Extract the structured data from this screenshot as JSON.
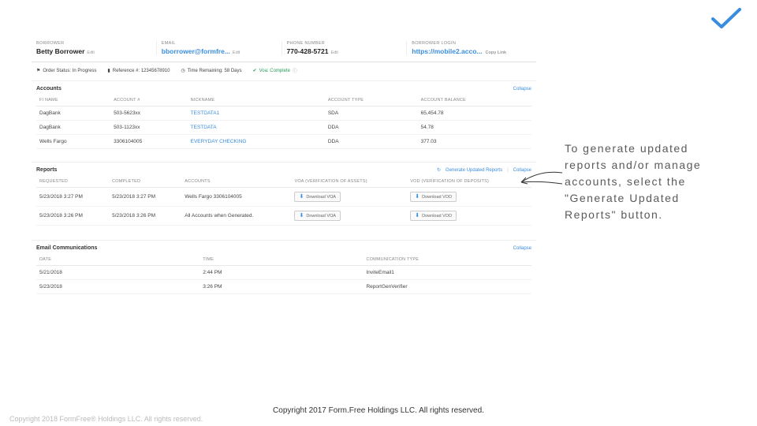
{
  "header": {
    "borrower_label": "BORROWER",
    "borrower_name": "Betty Borrower",
    "email_label": "EMAIL",
    "email_value": "bborrower@formfre...",
    "phone_label": "PHONE NUMBER",
    "phone_value": "770-428-5721",
    "url_label": "BORROWER LOGIN",
    "url_value": "https://mobile2.acco...",
    "edit": "Edit",
    "copy_link": "Copy Link"
  },
  "status": {
    "order": "Order Status: In Progress",
    "ref": "Reference #: 12345678910",
    "time": "Time Remaining: 58 Days",
    "voa": "Voa: Complete"
  },
  "accounts": {
    "title": "Accounts",
    "collapse": "Collapse",
    "cols": {
      "fi": "FI NAME",
      "acct": "ACCOUNT #",
      "nick": "NICKNAME",
      "type": "ACCOUNT TYPE",
      "bal": "ACCOUNT BALANCE"
    },
    "rows": [
      {
        "fi": "DagBank",
        "acct": "503-5623xx",
        "nick": "TESTDATA1",
        "type": "SDA",
        "bal": "65,454.78"
      },
      {
        "fi": "DagBank",
        "acct": "503-1123xx",
        "nick": "TESTDATA",
        "type": "DDA",
        "bal": "54.78"
      },
      {
        "fi": "Wells Fargo",
        "acct": "3306104005",
        "nick": "EVERYDAY CHECKING",
        "type": "DDA",
        "bal": "377.03"
      }
    ]
  },
  "reports": {
    "title": "Reports",
    "generate": "Generate Updated Reports",
    "collapse": "Collapse",
    "cols": {
      "req": "REQUESTED",
      "comp": "COMPLETED",
      "acct": "ACCOUNTS",
      "voa": "VOA (VERIFICATION OF ASSETS)",
      "vod": "VOD (VERIFICATION OF DEPOSITS)"
    },
    "rows": [
      {
        "req": "5/23/2018 3:27 PM",
        "comp": "5/23/2018 3:27 PM",
        "acct": "Wells Fargo 3306104005",
        "voa": "Download VOA",
        "vod": "Download VOD"
      },
      {
        "req": "5/23/2018 3:26 PM",
        "comp": "5/23/2018 3:26 PM",
        "acct": "All Accounts when Generated.",
        "voa": "Download VOA",
        "vod": "Download VOD"
      }
    ]
  },
  "emails": {
    "title": "Email Communications",
    "collapse": "Collapse",
    "cols": {
      "date": "DATE",
      "time": "TIME",
      "type": "COMMUNICATION TYPE"
    },
    "rows": [
      {
        "date": "5/21/2018",
        "time": "2:44 PM",
        "type": "InviteEmail1"
      },
      {
        "date": "5/23/2018",
        "time": "3:26 PM",
        "type": "ReportGenVerifier"
      }
    ]
  },
  "callout": "To generate updated reports and/or manage accounts, select the \"Generate Updated Reports\" button.",
  "copyright_main": "Copyright 2017 Form.Free Holdings LLC. All rights reserved.",
  "copyright_footer": "Copyright 2018 FormFree® Holdings LLC. All rights reserved."
}
